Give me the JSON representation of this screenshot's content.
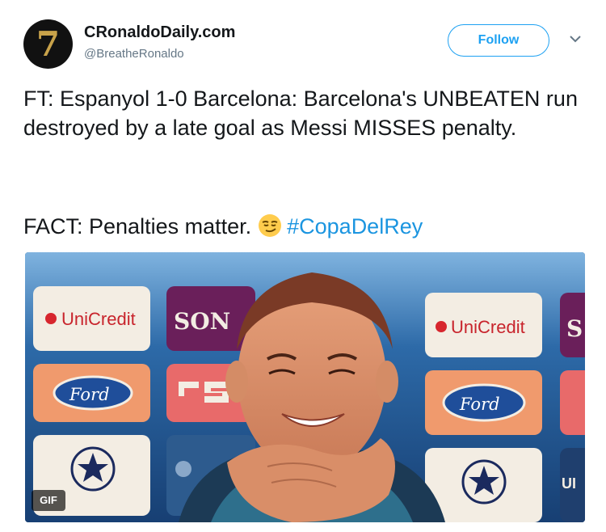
{
  "account": {
    "avatar_glyph": "7",
    "display_name": "CRonaldoDaily.com",
    "handle": "@BreatheRonaldo"
  },
  "actions": {
    "follow_label": "Follow",
    "more_icon": "chevron-down-icon"
  },
  "tweet": {
    "paragraph1": "FT: Espanyol 1-0 Barcelona: Barcelona's UNBEATEN run destroyed by a late goal as Messi MISSES penalty.",
    "paragraph2_text": "FACT: Penalties matter.",
    "emoji": "smirking-face-icon",
    "hashtag": "#CopaDelRey"
  },
  "media": {
    "badge": "GIF",
    "sponsor_boards": [
      "UniCredit",
      "SON",
      "UniCredit",
      "S",
      "Ford",
      "Ford",
      "UI"
    ]
  },
  "colors": {
    "accent": "#1da1f2",
    "hashtag": "#1b95e0",
    "text": "#14171a",
    "secondary": "#657786"
  }
}
